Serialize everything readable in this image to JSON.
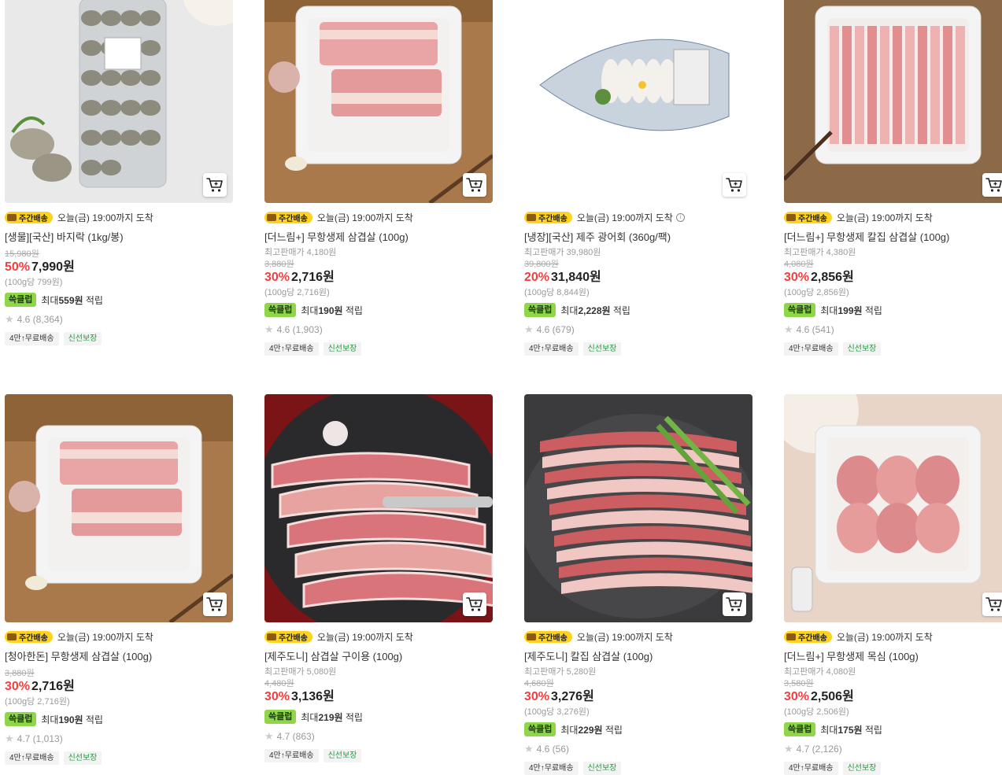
{
  "products": [
    {
      "delivery_badge": "주간배송",
      "delivery_text": "오늘(금) 19:00까지 도착",
      "delivery_info": false,
      "name": "[생물][국산] 바지락 (1kg/봉)",
      "max_price": "",
      "original_price": "15,980원",
      "discount": "50%",
      "price": "7,990원",
      "unit_price": "(100g당 799원)",
      "reward_badge": "쓱클럽",
      "reward_prefix": "최대",
      "reward_amount": "559원",
      "reward_suffix": "적립",
      "rating": "4.6 (8,364)",
      "tags": [
        "4만↑무료배송",
        "신선보장"
      ],
      "image": "clams-bag"
    },
    {
      "delivery_badge": "주간배송",
      "delivery_text": "오늘(금) 19:00까지 도착",
      "delivery_info": false,
      "name": "[더느림+] 무항생제 삼겹살 (100g)",
      "max_price": "최고판매가 4,180원",
      "original_price": "3,880원",
      "discount": "30%",
      "price": "2,716원",
      "unit_price": "(100g당 2,716원)",
      "reward_badge": "쓱클럽",
      "reward_prefix": "최대",
      "reward_amount": "190원",
      "reward_suffix": "적립",
      "rating": "4.6 (1,903)",
      "tags": [
        "4만↑무료배송",
        "신선보장"
      ],
      "image": "pork-tray-thick"
    },
    {
      "delivery_badge": "주간배송",
      "delivery_text": "오늘(금) 19:00까지 도착",
      "delivery_info": true,
      "name": "[냉장][국산] 제주 광어회 (360g/팩)",
      "max_price": "최고판매가 39,980원",
      "original_price": "39,800원",
      "discount": "20%",
      "price": "31,840원",
      "unit_price": "(100g당 8,844원)",
      "reward_badge": "쓱클럽",
      "reward_prefix": "최대",
      "reward_amount": "2,228원",
      "reward_suffix": "적립",
      "rating": "4.6 (679)",
      "tags": [
        "4만↑무료배송",
        "신선보장"
      ],
      "image": "sashimi-boat"
    },
    {
      "delivery_badge": "주간배송",
      "delivery_text": "오늘(금) 19:00까지 도착",
      "delivery_info": false,
      "name": "[더느림+] 무항생제 칼집 삼겹살 (100g)",
      "max_price": "최고판매가 4,380원",
      "original_price": "4,080원",
      "discount": "30%",
      "price": "2,856원",
      "unit_price": "(100g당 2,856원)",
      "reward_badge": "쓱클럽",
      "reward_prefix": "최대",
      "reward_amount": "199원",
      "reward_suffix": "적립",
      "rating": "4.6 (541)",
      "tags": [
        "4만↑무료배송",
        "신선보장"
      ],
      "image": "pork-tray-sliced"
    },
    {
      "delivery_badge": "주간배송",
      "delivery_text": "오늘(금) 19:00까지 도착",
      "delivery_info": false,
      "name": "[청아한돈] 무항생제 삼겹살 (100g)",
      "max_price": "",
      "original_price": "3,880원",
      "discount": "30%",
      "price": "2,716원",
      "unit_price": "(100g당 2,716원)",
      "reward_badge": "쓱클럽",
      "reward_prefix": "최대",
      "reward_amount": "190원",
      "reward_suffix": "적립",
      "rating": "4.7 (1,013)",
      "tags": [
        "4만↑무료배송",
        "신선보장"
      ],
      "image": "pork-tray-thick"
    },
    {
      "delivery_badge": "주간배송",
      "delivery_text": "오늘(금) 19:00까지 도착",
      "delivery_info": false,
      "name": "[제주도니] 삼겹살 구이용 (100g)",
      "max_price": "최고판매가 5,080원",
      "original_price": "4,480원",
      "discount": "30%",
      "price": "3,136원",
      "unit_price": "",
      "reward_badge": "쓱클럽",
      "reward_prefix": "최대",
      "reward_amount": "219원",
      "reward_suffix": "적립",
      "rating": "4.7 (863)",
      "tags": [
        "4만↑무료배송",
        "신선보장"
      ],
      "image": "pork-grill"
    },
    {
      "delivery_badge": "주간배송",
      "delivery_text": "오늘(금) 19:00까지 도착",
      "delivery_info": false,
      "name": "[제주도니] 칼집 삼겹살 (100g)",
      "max_price": "최고판매가 5,280원",
      "original_price": "4,680원",
      "discount": "30%",
      "price": "3,276원",
      "unit_price": "(100g당 3,276원)",
      "reward_badge": "쓱클럽",
      "reward_prefix": "최대",
      "reward_amount": "229원",
      "reward_suffix": "적립",
      "rating": "4.6 (56)",
      "tags": [
        "4만↑무료배송",
        "신선보장"
      ],
      "image": "pork-asparagus"
    },
    {
      "delivery_badge": "주간배송",
      "delivery_text": "오늘(금) 19:00까지 도착",
      "delivery_info": false,
      "name": "[더느림+] 무항생제 목심 (100g)",
      "max_price": "최고판매가 4,080원",
      "original_price": "3,580원",
      "discount": "30%",
      "price": "2,506원",
      "unit_price": "(100g당 2,506원)",
      "reward_badge": "쓱클럽",
      "reward_prefix": "최대",
      "reward_amount": "175원",
      "reward_suffix": "적립",
      "rating": "4.7 (2,126)",
      "tags": [
        "4만↑무료배송",
        "신선보장"
      ],
      "image": "pork-neck"
    }
  ],
  "icons": {
    "cart": "cart-icon",
    "star": "star-icon",
    "delivery": "truck-icon",
    "info": "info-icon"
  },
  "colors": {
    "discount": "#f53d3d",
    "reward_badge": "#8fd64a",
    "delivery_badge": "#ffd21f",
    "fresh_tag": "#1f9c3c"
  }
}
